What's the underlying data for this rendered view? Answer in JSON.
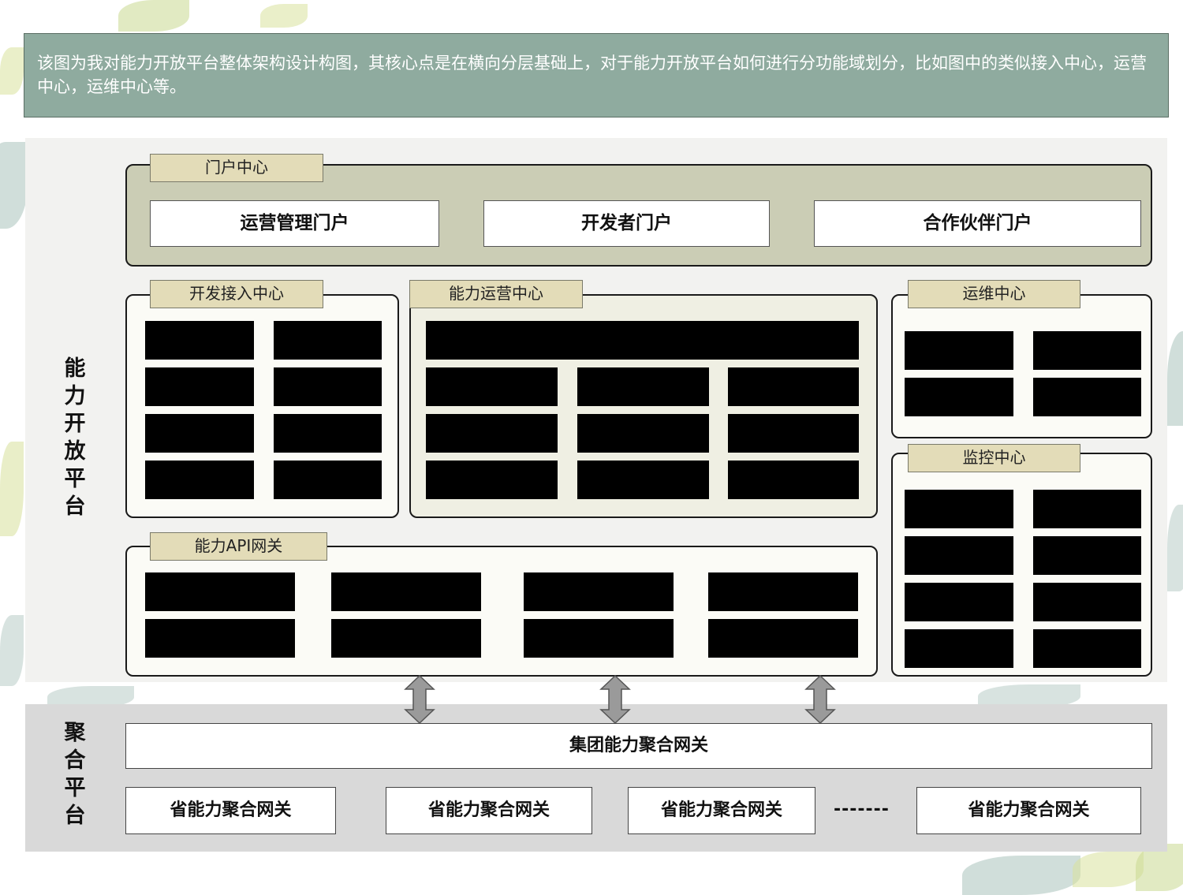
{
  "banner": {
    "text": "该图为我对能力开放平台整体架构设计构图，其核心点是在横向分层基础上，对于能力开放平台如何进行分功能域划分，比如图中的类似接入中心，运营中心，运维中心等。"
  },
  "platform_label": "能力开放平台",
  "portal_center": {
    "tag": "门户中心",
    "portals": [
      "运营管理门户",
      "开发者门户",
      "合作伙伴门户"
    ]
  },
  "dev_access_center": {
    "tag": "开发接入中心"
  },
  "ability_ops_center": {
    "tag": "能力运营中心"
  },
  "ops_center": {
    "tag": "运维中心"
  },
  "monitor_center": {
    "tag": "监控中心"
  },
  "api_gateway": {
    "tag": "能力API网关"
  },
  "aggregation_label": "聚合平台",
  "aggregation": {
    "group_gateway": "集团能力聚合网关",
    "provincial_gateways": [
      "省能力聚合网关",
      "省能力聚合网关",
      "省能力聚合网关",
      "省能力聚合网关"
    ],
    "ellipsis": "-------"
  },
  "colors": {
    "banner": "#8fab9f",
    "portal_panel": "#cbcdb5",
    "tag": "#e3dcb8",
    "redacted_block": "#000000",
    "arrow": "#999999"
  }
}
